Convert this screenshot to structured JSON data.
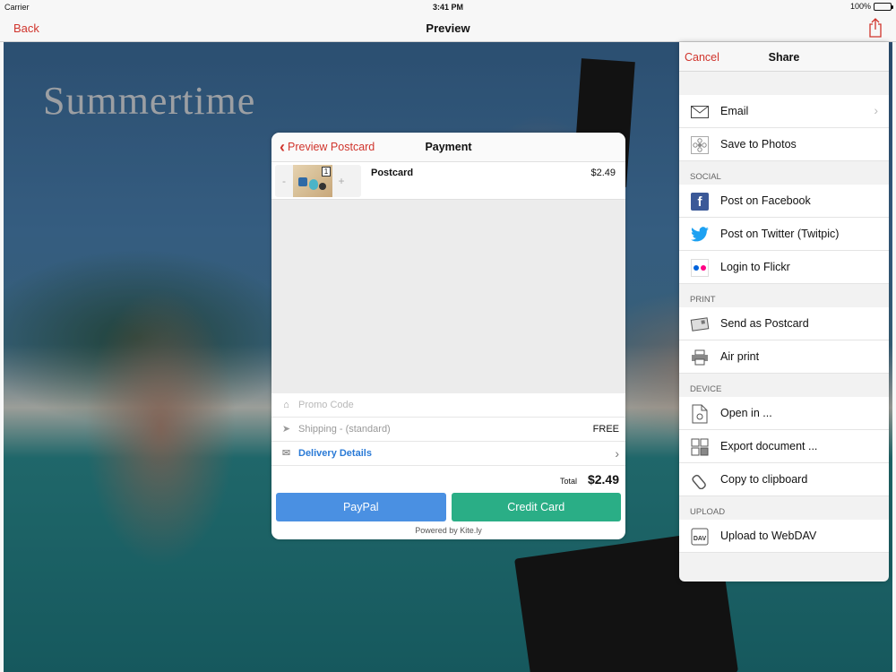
{
  "status": {
    "carrier": "Carrier",
    "time": "3:41 PM",
    "battery": "100%"
  },
  "nav": {
    "back_label": "Back",
    "title": "Preview"
  },
  "photo": {
    "headline": "Summertime"
  },
  "payment": {
    "back_label": "Preview Postcard",
    "title": "Payment",
    "item": {
      "name": "Postcard",
      "price": "$2.49",
      "quantity": "1",
      "minus": "-",
      "plus": "+"
    },
    "promo_placeholder": "Promo Code",
    "shipping_label": "Shipping - (standard)",
    "shipping_value": "FREE",
    "delivery_label": "Delivery Details",
    "total_label": "Total",
    "total_value": "$2.49",
    "paypal_label": "PayPal",
    "card_label": "Credit Card",
    "powered_by": "Powered by Kite.ly"
  },
  "share": {
    "cancel_label": "Cancel",
    "title": "Share",
    "sections": {
      "social": "SOCIAL",
      "print": "PRINT",
      "device": "DEVICE",
      "upload": "UPLOAD"
    },
    "items": {
      "email": "Email",
      "save_photos": "Save to Photos",
      "facebook": "Post on Facebook",
      "twitter": "Post on Twitter (Twitpic)",
      "flickr": "Login to Flickr",
      "postcard": "Send as Postcard",
      "airprint": "Air print",
      "open_in": "Open in ...",
      "export": "Export document ...",
      "clipboard": "Copy to clipboard",
      "webdav": "Upload to WebDAV"
    },
    "fb_glyph": "f",
    "dav_glyph": "DAV"
  },
  "colors": {
    "accent": "#d0342c",
    "link": "#2a7ad6",
    "paypal": "#4a90e2",
    "card": "#2aae86",
    "facebook": "#3b5998",
    "twitter": "#1da1f2"
  }
}
